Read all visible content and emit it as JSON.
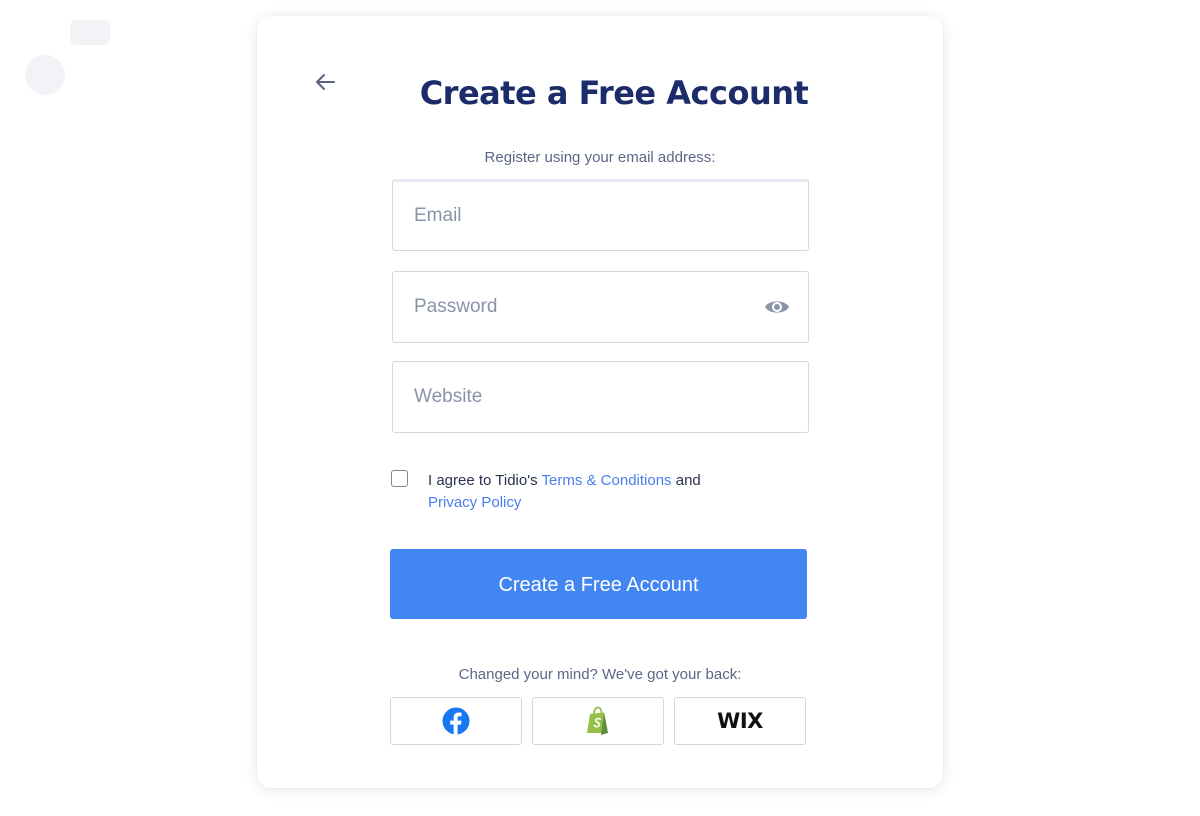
{
  "form": {
    "title": "Create a Free Account",
    "subtitle": "Register using your email address:",
    "email_placeholder": "Email",
    "password_placeholder": "Password",
    "website_placeholder": "Website",
    "agree": {
      "prefix": "I agree to Tidio's ",
      "terms_link": "Terms & Conditions",
      "middle": " and",
      "privacy_link": "Privacy Policy"
    },
    "submit_label": "Create a Free Account",
    "alt_prompt": "Changed your mind? We've got your back:",
    "wix_label": "WIX"
  },
  "icons": {
    "back": "arrow-left-icon",
    "eye": "eye-icon",
    "facebook": "facebook-icon",
    "shopify": "shopify-icon",
    "wix": "wix-logo"
  },
  "colors": {
    "title": "#1c2b6a",
    "primary": "#4286f4",
    "link": "#4a7de8",
    "facebook": "#1877f2",
    "shopify": "#95bf47"
  }
}
